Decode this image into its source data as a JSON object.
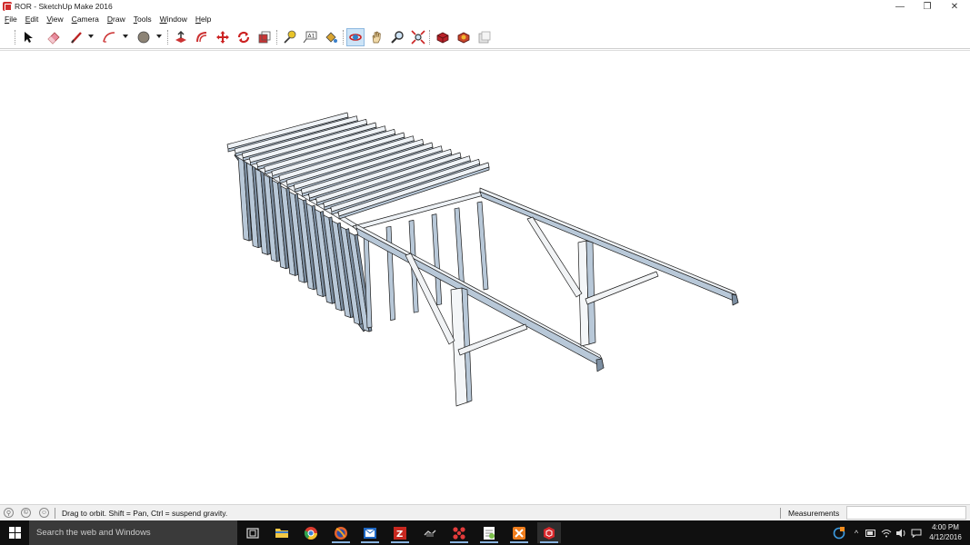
{
  "window": {
    "title": "ROR - SketchUp Make 2016",
    "controls": {
      "minimize": "—",
      "restore": "❐",
      "close": "✕"
    }
  },
  "menubar": {
    "items": [
      {
        "first": "F",
        "rest": "ile"
      },
      {
        "first": "E",
        "rest": "dit"
      },
      {
        "first": "V",
        "rest": "iew"
      },
      {
        "first": "C",
        "rest": "amera"
      },
      {
        "first": "D",
        "rest": "raw"
      },
      {
        "first": "T",
        "rest": "ools"
      },
      {
        "first": "W",
        "rest": "indow"
      },
      {
        "first": "H",
        "rest": "elp"
      }
    ]
  },
  "toolbar": {
    "tools": [
      "select-icon",
      "eraser-icon",
      "line-icon",
      "arc-icon",
      "shape-icon",
      "push-pull-icon",
      "offset-icon",
      "move-icon",
      "rotate-icon",
      "scale-icon",
      "tape-measure-icon",
      "text-icon",
      "paint-bucket-icon",
      "orbit-icon",
      "pan-icon",
      "zoom-icon",
      "zoom-extents-icon",
      "warehouse-icon",
      "extension-warehouse-icon",
      "layout-icon"
    ],
    "active_tool": "orbit-icon"
  },
  "statusbar": {
    "message": "Drag to orbit. Shift = Pan, Ctrl = suspend gravity.",
    "measurements_label": "Measurements",
    "measurements_value": ""
  },
  "taskbar": {
    "search_placeholder": "Search the web and Windows",
    "time": "4:00 PM",
    "date": "4/12/2016",
    "apps": [
      "task-view-icon",
      "file-explorer-icon",
      "chrome-icon",
      "firefox-icon",
      "outlook-icon",
      "filezilla-icon",
      "app-icon",
      "app-grid-icon",
      "notepad-plus-icon",
      "xampp-icon",
      "sketchup-icon"
    ]
  },
  "colors": {
    "frame_top": "#eef2f6",
    "frame_side": "#b8c8d8",
    "frame_dark": "#7d8fa2",
    "outline": "#1a1a1a",
    "taskbar": "#101010",
    "search_bg": "#3a3a3a"
  }
}
